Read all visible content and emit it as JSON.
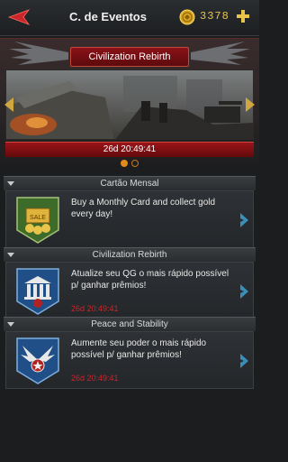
{
  "header": {
    "title": "C. de Eventos",
    "gold_amount": "3378"
  },
  "banner": {
    "event_name": "Civilization Rebirth",
    "timer": "26d 20:49:41",
    "page_count": 2,
    "active_page": 1
  },
  "sections": [
    {
      "header": "Cartão Mensal",
      "description": "Buy a Monthly Card and collect gold every day!",
      "time": "",
      "icon": "monthly-card-gold-icon"
    },
    {
      "header": "Civilization Rebirth",
      "description": "Atualize seu QG o mais rápido possível p/ ganhar prêmios!",
      "time": "26d 20:49:41",
      "icon": "hq-building-icon"
    },
    {
      "header": "Peace and Stability",
      "description": "Aumente seu poder o mais rápido possível p/ ganhar prêmios!",
      "time": "26d 20:49:41",
      "icon": "power-wings-icon"
    }
  ],
  "colors": {
    "accent_red": "#9a1419",
    "gold": "#e9c44a",
    "timer_text": "#c8262b",
    "card_arrow": "#3a8fb8"
  }
}
